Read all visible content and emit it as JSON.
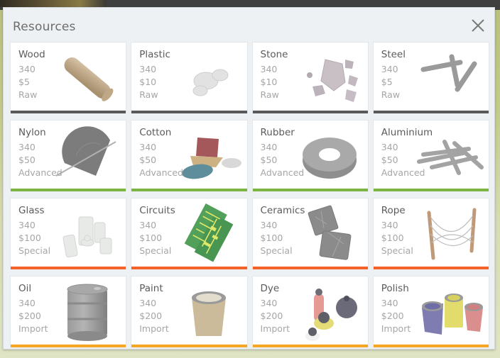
{
  "window": {
    "title": "Resources",
    "close_icon": "close-icon"
  },
  "colors": {
    "panel_bg": "#eef1f3",
    "card_bg": "#ffffff",
    "title_text": "#6d6d6d",
    "name_text": "#5b5b5b",
    "meta_text": "#a6a6a6",
    "tier_raw": "#595959",
    "tier_advanced": "#7cb342",
    "tier_special": "#f4622a",
    "tier_import": "#f5a623",
    "game_backdrop": "#c2cb88"
  },
  "grid": {
    "rows": [
      {
        "tier": "Raw",
        "accent": "#595959",
        "cards": [
          {
            "name": "Wood",
            "amount": "340",
            "price": "$5",
            "tier": "Raw",
            "art": "wood-log-icon"
          },
          {
            "name": "Plastic",
            "amount": "340",
            "price": "$10",
            "tier": "Raw",
            "art": "plastic-icon"
          },
          {
            "name": "Stone",
            "amount": "340",
            "price": "$10",
            "tier": "Raw",
            "art": "stone-rocks-icon"
          },
          {
            "name": "Steel",
            "amount": "340",
            "price": "$5",
            "tier": "Raw",
            "art": "steel-bars-icon"
          }
        ]
      },
      {
        "tier": "Advanced",
        "accent": "#7cb342",
        "cards": [
          {
            "name": "Nylon",
            "amount": "340",
            "price": "$50",
            "tier": "Advanced",
            "art": "nylon-umbrella-icon"
          },
          {
            "name": "Cotton",
            "amount": "340",
            "price": "$50",
            "tier": "Advanced",
            "art": "cotton-bales-icon"
          },
          {
            "name": "Rubber",
            "amount": "340",
            "price": "$50",
            "tier": "Advanced",
            "art": "rubber-tire-icon"
          },
          {
            "name": "Aluminium",
            "amount": "340",
            "price": "$50",
            "tier": "Advanced",
            "art": "aluminium-rods-icon"
          }
        ]
      },
      {
        "tier": "Special",
        "accent": "#f4622a",
        "cards": [
          {
            "name": "Glass",
            "amount": "340",
            "price": "$100",
            "tier": "Special",
            "art": "glass-jars-icon"
          },
          {
            "name": "Circuits",
            "amount": "340",
            "price": "$100",
            "tier": "Special",
            "art": "circuit-board-icon"
          },
          {
            "name": "Ceramics",
            "amount": "340",
            "price": "$100",
            "tier": "Special",
            "art": "ceramic-tiles-icon"
          },
          {
            "name": "Rope",
            "amount": "340",
            "price": "$100",
            "tier": "Special",
            "art": "rope-icon"
          }
        ]
      },
      {
        "tier": "Import",
        "accent": "#f5a623",
        "cards": [
          {
            "name": "Oil",
            "amount": "340",
            "price": "$200",
            "tier": "Import",
            "art": "oil-barrel-icon"
          },
          {
            "name": "Paint",
            "amount": "340",
            "price": "$200",
            "tier": "Import",
            "art": "paint-bucket-icon"
          },
          {
            "name": "Dye",
            "amount": "340",
            "price": "$200",
            "tier": "Import",
            "art": "dye-bottles-icon"
          },
          {
            "name": "Polish",
            "amount": "340",
            "price": "$200",
            "tier": "Import",
            "art": "polish-tins-icon"
          }
        ]
      }
    ]
  }
}
